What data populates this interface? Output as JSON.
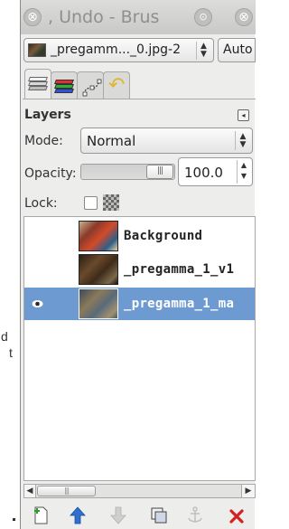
{
  "background": {
    "partial_text_1": "d",
    "partial_text_2": "t"
  },
  "dock": {
    "title": ", Undo - Brus",
    "title_buttons": {
      "close": "⊗",
      "minimize": "⊙",
      "maximize": "⊗"
    },
    "image_selector": {
      "value": "_pregamm..._0.jpg-2",
      "arrows": "⌃⌄"
    },
    "auto_button": "Auto"
  },
  "tabs": [
    {
      "name": "layers",
      "icon": "layers-icon",
      "active": true
    },
    {
      "name": "channels",
      "icon": "channels-icon",
      "active": false
    },
    {
      "name": "paths",
      "icon": "paths-icon",
      "active": false
    },
    {
      "name": "undo-history",
      "icon": "undo-icon",
      "active": false
    }
  ],
  "layers_panel": {
    "title": "Layers",
    "mode_label": "Mode:",
    "mode_value": "Normal",
    "opacity_label": "Opacity:",
    "opacity_value": "100.0",
    "opacity_fraction": 1.0,
    "lock_label": "Lock:",
    "layers": [
      {
        "name": "Background",
        "visible": false,
        "selected": false
      },
      {
        "name": "_pregamma_1_v1",
        "visible": false,
        "selected": false
      },
      {
        "name": "_pregamma_1_ma",
        "visible": true,
        "selected": true
      }
    ]
  },
  "toolbar": {
    "buttons": [
      {
        "name": "new-layer-button",
        "icon": "new-layer-icon"
      },
      {
        "name": "raise-layer-button",
        "icon": "arrow-up-icon"
      },
      {
        "name": "lower-layer-button",
        "icon": "arrow-down-icon"
      },
      {
        "name": "duplicate-layer-button",
        "icon": "duplicate-icon"
      },
      {
        "name": "anchor-layer-button",
        "icon": "anchor-icon"
      },
      {
        "name": "delete-layer-button",
        "icon": "delete-icon"
      }
    ]
  },
  "colors": {
    "selection": "#6e9ad2",
    "raise_arrow": "#2e6fd0",
    "delete": "#d52020",
    "undo_icon": "#e0b62a"
  }
}
